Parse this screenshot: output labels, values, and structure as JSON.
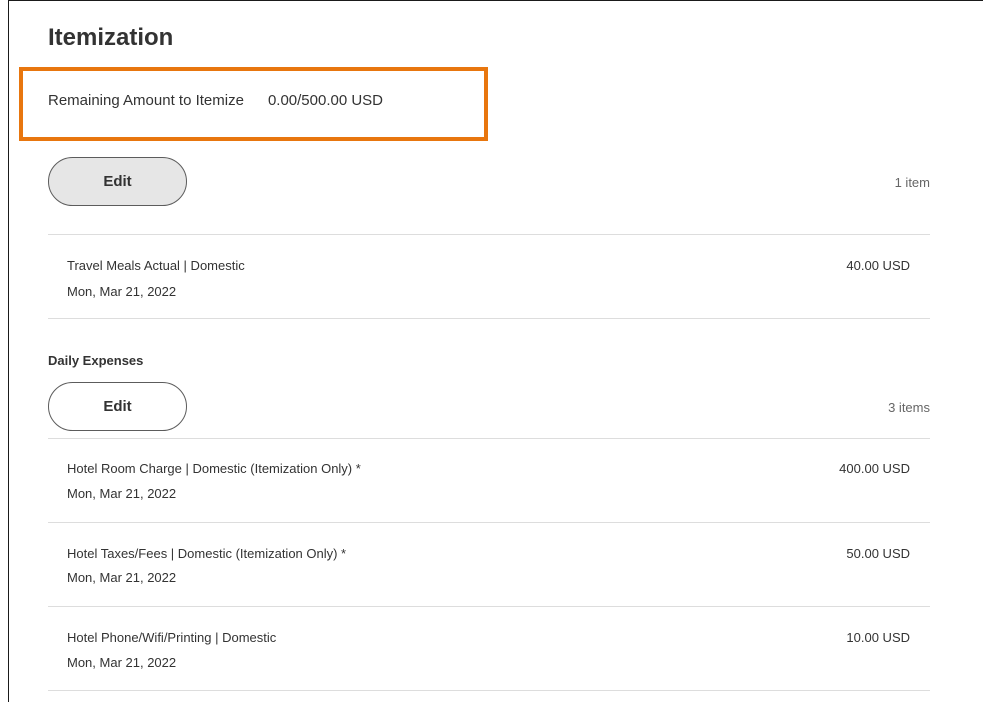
{
  "title": "Itemization",
  "remaining": {
    "label": "Remaining Amount to Itemize",
    "value": "0.00/500.00 USD"
  },
  "section1": {
    "edit_label": "Edit",
    "count": "1 item",
    "items": [
      {
        "title": "Travel Meals Actual | Domestic",
        "date": "Mon, Mar 21, 2022",
        "amount": "40.00 USD"
      }
    ]
  },
  "section2": {
    "heading": "Daily Expenses",
    "edit_label": "Edit",
    "count": "3 items",
    "items": [
      {
        "title": "Hotel Room Charge | Domestic (Itemization Only) *",
        "date": "Mon, Mar 21, 2022",
        "amount": "400.00 USD"
      },
      {
        "title": "Hotel Taxes/Fees | Domestic (Itemization Only) *",
        "date": "Mon, Mar 21, 2022",
        "amount": "50.00 USD"
      },
      {
        "title": "Hotel Phone/Wifi/Printing | Domestic",
        "date": "Mon, Mar 21, 2022",
        "amount": "10.00 USD"
      }
    ]
  },
  "colors": {
    "highlight": "#e8760e",
    "edit_shaded": "#e6e6e6",
    "divider": "#dddddd"
  }
}
